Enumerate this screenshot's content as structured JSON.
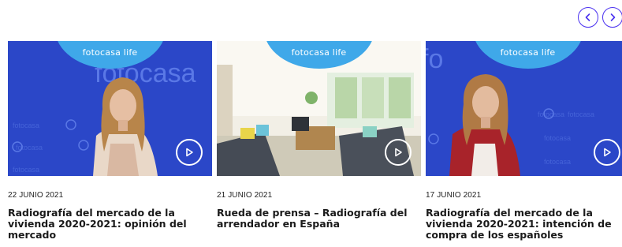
{
  "nav": {
    "prev_icon": "chevron-left-icon",
    "next_icon": "chevron-right-icon",
    "accent": "#4a31f0"
  },
  "cards": [
    {
      "badge": "fotocasa life",
      "date": "22 JUNIO 2021",
      "title": "Radiografía del mercado de la vivienda 2020-2021: opinión del mercado",
      "play_icon": "play-icon"
    },
    {
      "badge": "fotocasa life",
      "date": "21 JUNIO 2021",
      "title": "Rueda de prensa – Radiografía del arrendador en España",
      "play_icon": "play-icon"
    },
    {
      "badge": "fotocasa life",
      "date": "17 JUNIO 2021",
      "title": "Radiografía del mercado de la vivienda 2020-2021: intención de compra de los españoles",
      "play_icon": "play-icon"
    }
  ],
  "colors": {
    "badge": "#3fa8e9",
    "video_bg": "#2a47c9"
  }
}
